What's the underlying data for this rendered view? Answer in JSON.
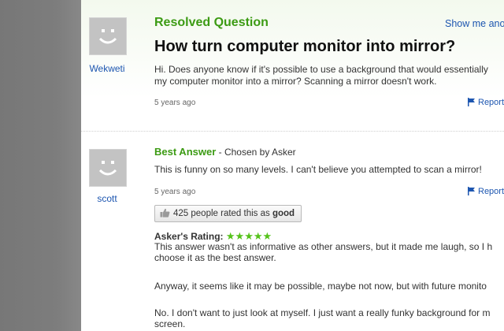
{
  "question": {
    "status_label": "Resolved Question",
    "show_me_link": "Show me ano",
    "title": "How turn computer monitor into mirror?",
    "body": "Hi. Does anyone know if it's possible to use a background that would essentially\nmy computer monitor into a mirror? Scanning a mirror doesn't work.",
    "timestamp": "5 years ago",
    "report_label": "Report",
    "asker": {
      "username": "Wekweti",
      "avatar_icon": "default-avatar-smiley-icon"
    }
  },
  "best_answer": {
    "label": "Best Answer",
    "chosen_by": " - Chosen by Asker",
    "text": "This is funny on so many levels. I can't believe you attempted to scan a mirror!",
    "timestamp": "5 years ago",
    "report_label": "Report",
    "answerer": {
      "username": "scott",
      "avatar_icon": "default-avatar-smiley-icon"
    },
    "rating_button": {
      "count": "425",
      "prefix": " people rated this as ",
      "rating_word": "good"
    },
    "askers_rating": {
      "label": "Asker's Rating:",
      "stars": "★★★★★",
      "comments": [
        "This answer wasn't as informative as other answers, but it made me laugh, so I h\nchoose it as the best answer.",
        "Anyway, it seems like it may be possible, maybe not now, but with future monito",
        "No. I don't want to just look at myself. I just want a really funky background for m\nscreen."
      ]
    }
  },
  "colors": {
    "accent_green": "#3c9b14",
    "link_blue": "#1d56b0",
    "star_green": "#55c21a",
    "sidebar_gray": "#7d7d7d"
  }
}
